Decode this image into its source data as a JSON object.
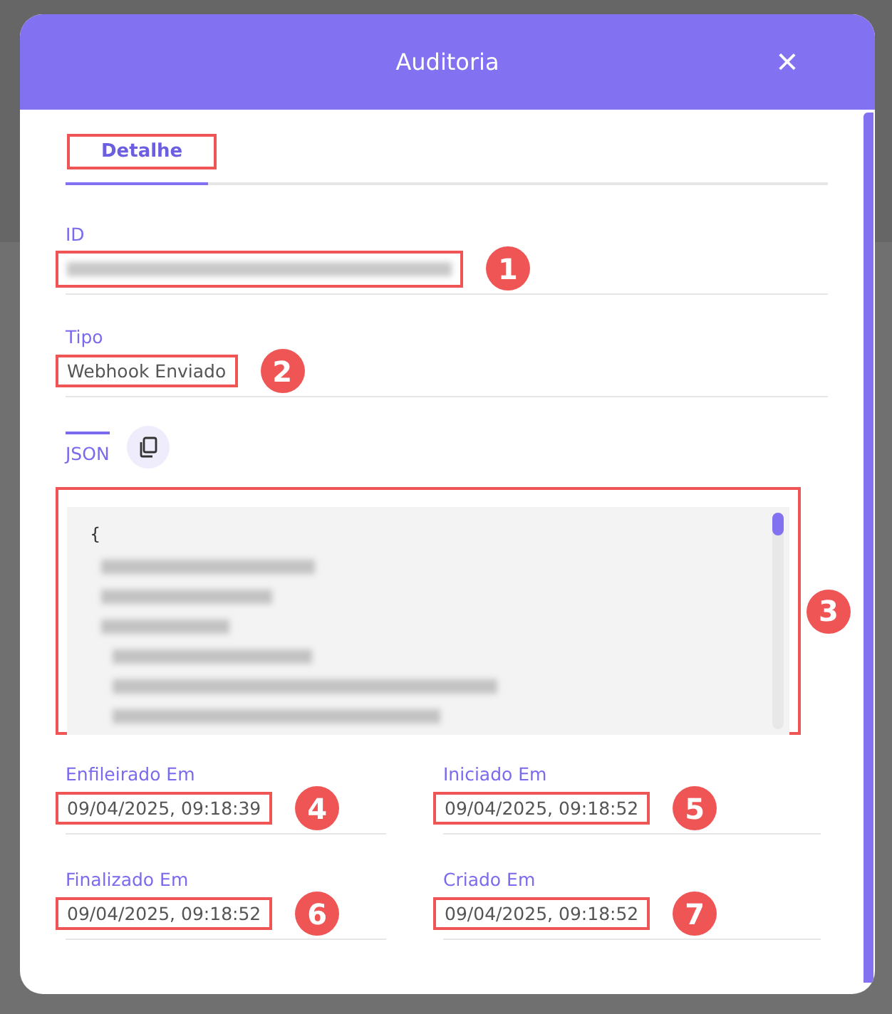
{
  "dialog": {
    "title": "Auditoria",
    "close": "×"
  },
  "tabs": [
    {
      "label": "Detalhe",
      "selected": true,
      "highlighted": true
    }
  ],
  "fields": [
    {
      "label": "ID",
      "redacted": true,
      "callout": "1"
    },
    {
      "label": "Tipo",
      "value": "Webhook Enviado",
      "callout": "2"
    }
  ],
  "json_section": {
    "label": "JSON",
    "callout": "3",
    "first_line": "{"
  },
  "dates": [
    {
      "label": "Enfileirado Em",
      "value": "09/04/2025, 09:18:39",
      "callout": "4"
    },
    {
      "label": "Iniciado Em",
      "value": "09/04/2025, 09:18:52",
      "callout": "5"
    },
    {
      "label": "Finalizado Em",
      "value": "09/04/2025, 09:18:52",
      "callout": "6"
    },
    {
      "label": "Criado Em",
      "value": "09/04/2025, 09:18:52",
      "callout": "7"
    }
  ]
}
